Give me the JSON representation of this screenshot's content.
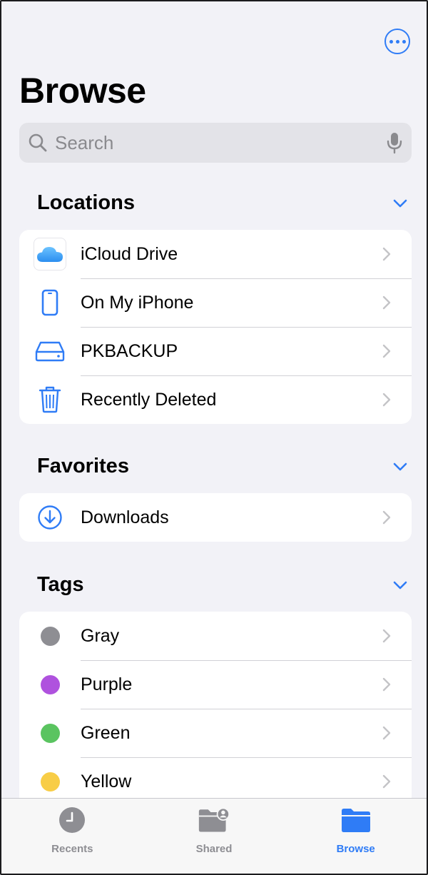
{
  "header": {
    "title": "Browse",
    "more_icon": "ellipsis-circle-icon"
  },
  "search": {
    "placeholder": "Search",
    "value": ""
  },
  "sections": {
    "locations": {
      "title": "Locations",
      "items": [
        {
          "label": "iCloud Drive",
          "icon": "icloud-icon"
        },
        {
          "label": "On My iPhone",
          "icon": "iphone-icon"
        },
        {
          "label": "PKBACKUP",
          "icon": "external-drive-icon"
        },
        {
          "label": "Recently Deleted",
          "icon": "trash-icon"
        }
      ]
    },
    "favorites": {
      "title": "Favorites",
      "items": [
        {
          "label": "Downloads",
          "icon": "download-circle-icon"
        }
      ]
    },
    "tags": {
      "title": "Tags",
      "items": [
        {
          "label": "Gray",
          "color": "#8e8e93"
        },
        {
          "label": "Purple",
          "color": "#af52de"
        },
        {
          "label": "Green",
          "color": "#5ac460"
        },
        {
          "label": "Yellow",
          "color": "#f8cd46"
        }
      ]
    }
  },
  "tabbar": {
    "tabs": [
      {
        "label": "Recents",
        "icon": "clock-icon",
        "active": false
      },
      {
        "label": "Shared",
        "icon": "shared-folder-icon",
        "active": false
      },
      {
        "label": "Browse",
        "icon": "folder-icon",
        "active": true
      }
    ]
  },
  "colors": {
    "accent": "#2f7cf6",
    "background": "#f2f2f7",
    "inactive": "#8e8e93"
  }
}
